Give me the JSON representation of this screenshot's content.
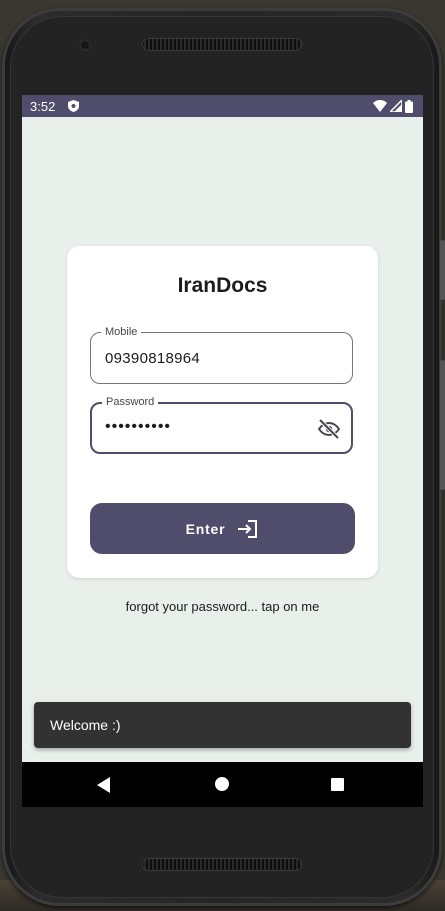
{
  "status_bar": {
    "time": "3:52",
    "icons": [
      "shield-icon",
      "wifi-icon",
      "signal-icon",
      "battery-icon"
    ]
  },
  "app": {
    "title": "IranDocs",
    "mobile_field": {
      "label": "Mobile",
      "value": "09390818964"
    },
    "password_field": {
      "label": "Password",
      "value": "••••••••••"
    },
    "enter_button": {
      "label": "Enter",
      "icon": "login-icon"
    },
    "forgot_link": "forgot your password... tap on me"
  },
  "snackbar": {
    "message": "Welcome :)"
  },
  "navigation_bar": {
    "buttons": [
      "back-icon",
      "home-icon",
      "recents-icon"
    ]
  },
  "colors": {
    "accent": "#4f4d6b",
    "background": "#e9efeb",
    "card": "#ffffff",
    "snackbar": "#323232"
  }
}
